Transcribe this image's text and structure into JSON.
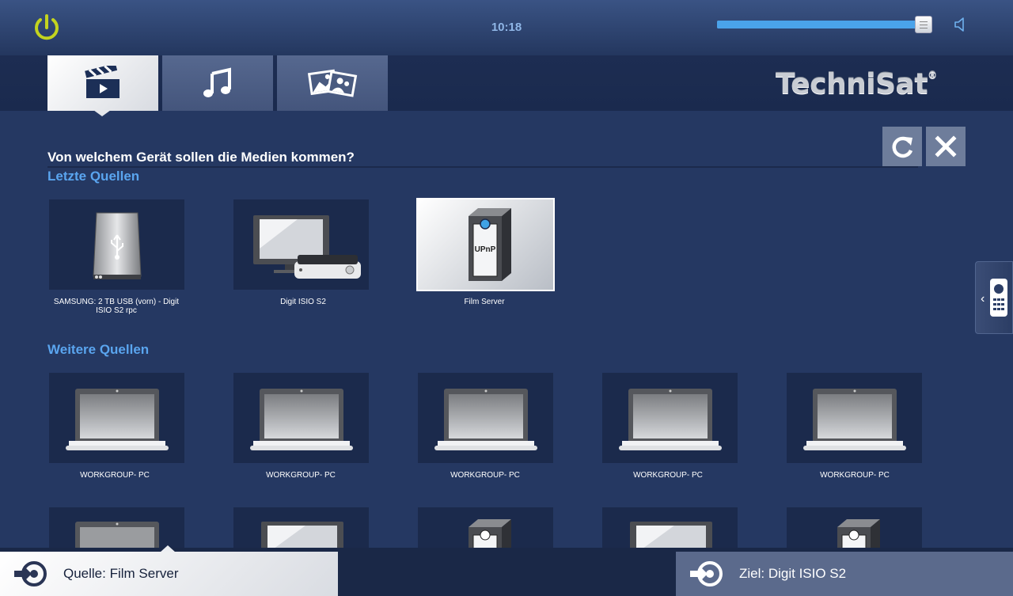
{
  "colors": {
    "accent": "#5aa5ef",
    "background": "#253862",
    "power": "#c3d41f"
  },
  "header": {
    "time": "10:18",
    "volume_level": 0.96
  },
  "tabs": [
    {
      "name": "video",
      "icon": "clapperboard-icon",
      "active": true
    },
    {
      "name": "music",
      "icon": "music-note-icon",
      "active": false
    },
    {
      "name": "photos",
      "icon": "photos-icon",
      "active": false
    }
  ],
  "logo": {
    "text": "TechniSat",
    "mark": "®"
  },
  "main": {
    "question": "Von welchem Gerät sollen die Medien kommen?",
    "recent_title": "Letzte Quellen",
    "more_title": "Weitere Quellen",
    "recent": [
      {
        "label": "SAMSUNG: 2 TB USB (vorn) - Digit ISIO S2 rpc",
        "icon": "usb-drive-icon"
      },
      {
        "label": "Digit ISIO S2",
        "icon": "tv-receiver-icon"
      },
      {
        "label": "Film Server",
        "icon": "upnp-server-icon",
        "upnp_text": "UPnP"
      }
    ],
    "more": [
      {
        "label": "WORKGROUP- PC",
        "icon": "laptop-icon"
      },
      {
        "label": "WORKGROUP- PC",
        "icon": "laptop-icon"
      },
      {
        "label": "WORKGROUP- PC",
        "icon": "laptop-icon"
      },
      {
        "label": "WORKGROUP- PC",
        "icon": "laptop-icon"
      },
      {
        "label": "WORKGROUP- PC",
        "icon": "laptop-icon"
      }
    ]
  },
  "bottom": {
    "source_label": "Quelle: Film Server",
    "target_label": "Ziel: Digit ISIO S2"
  }
}
